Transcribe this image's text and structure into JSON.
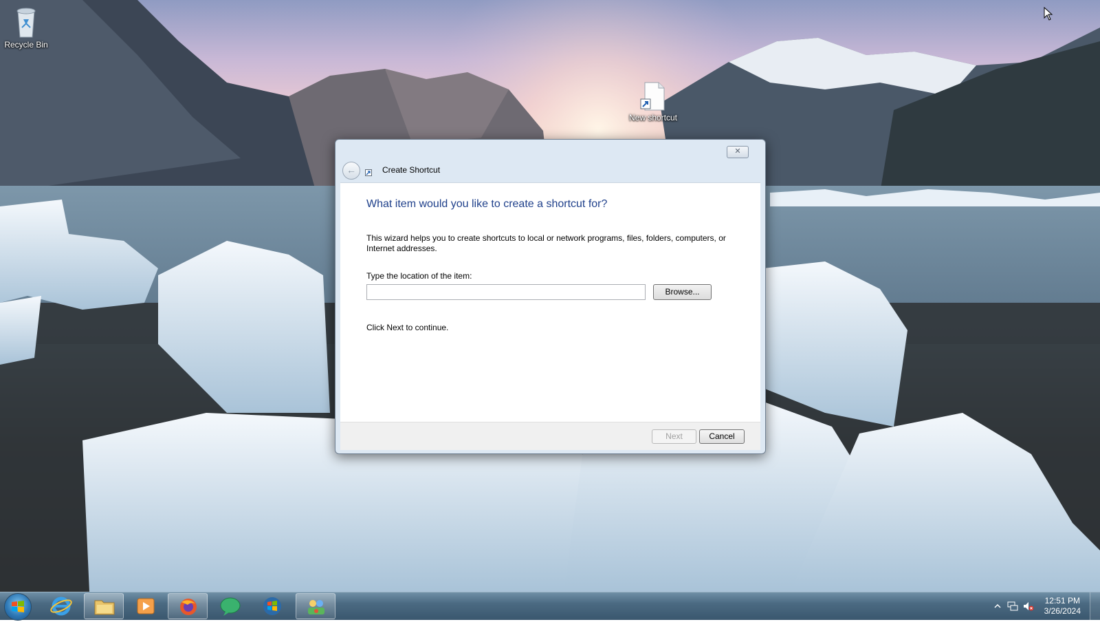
{
  "desktop": {
    "icons": [
      {
        "label": "Recycle Bin",
        "icon": "recycle-bin-icon"
      },
      {
        "label": "New shortcut",
        "icon": "shortcut-file-icon"
      }
    ]
  },
  "dialog": {
    "title": "Create Shortcut",
    "close_label": "✕",
    "back_label": "←",
    "heading": "What item would you like to create a shortcut for?",
    "description": "This wizard helps you to create shortcuts to local or network programs, files, folders, computers, or Internet addresses.",
    "location_label": "Type the location of the item:",
    "location_value": "",
    "browse_label": "Browse...",
    "hint": "Click Next to continue.",
    "next_label": "Next",
    "cancel_label": "Cancel"
  },
  "taskbar": {
    "items": [
      {
        "icon": "start-orb-icon"
      },
      {
        "icon": "internet-explorer-icon"
      },
      {
        "icon": "file-explorer-icon"
      },
      {
        "icon": "media-player-icon"
      },
      {
        "icon": "firefox-icon"
      },
      {
        "icon": "chat-icon"
      },
      {
        "icon": "windows-logo-icon"
      },
      {
        "icon": "control-panel-icon"
      }
    ],
    "time": "12:51 PM",
    "date": "3/26/2024"
  },
  "colors": {
    "heading_blue": "#1e3f8a",
    "taskbar": "#4b6a82"
  }
}
